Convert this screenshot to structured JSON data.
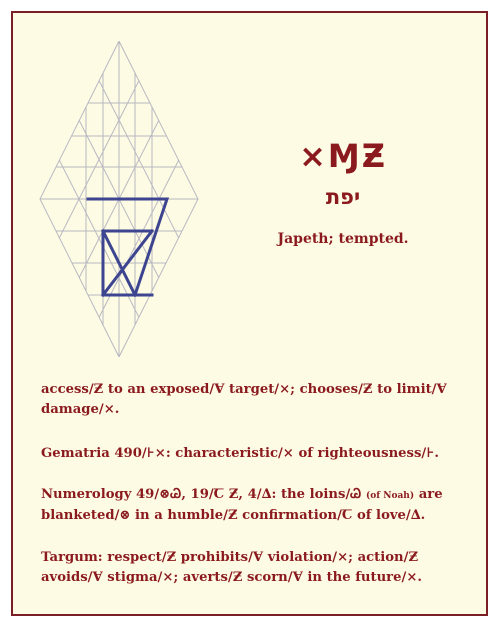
{
  "glyph_title": "⨯ⱮƵ",
  "hebrew": "יפת",
  "meaning": "Japeth; tempted.",
  "paragraphs": [
    "access/Ƶ to an exposed/Ɐ target/⨯; chooses/Ƶ to limit/Ɐ damage/⨯.",
    "Gematria 490/⊦⨯: characteristic/⨯ of righteousness/⊦.",
    "Numerology 49/⊗Ꮚ, 19/Ꞇ Ƶ, 4/∆: the loins/Ꮚ",
    "(of Noah)",
    "are blanketed/⊗ in a humble/Ƶ confirmation/Ꞇ of love/∆.",
    "Targum: respect/Ƶ prohibits/Ɐ violation/⨯; action/Ƶ avoids/Ɐ stigma/⨯; averts/Ƶ scorn/Ɐ in the future/⨯."
  ],
  "colors": {
    "accent": "#8b1a1f",
    "border": "#7a1f24",
    "card_bg": "#fdfbe4",
    "grid_line": "#b8b8c2",
    "glyph_stroke": "#3d4590"
  }
}
